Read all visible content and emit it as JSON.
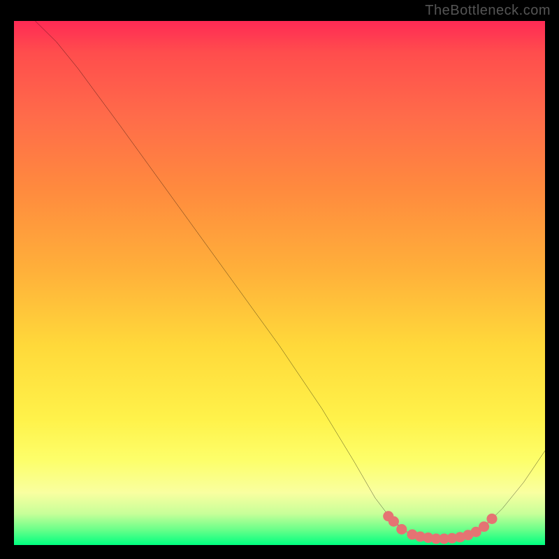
{
  "attribution": "TheBottleneck.com",
  "chart_data": {
    "type": "line",
    "title": "",
    "xlabel": "",
    "ylabel": "",
    "xlim": [
      0,
      100
    ],
    "ylim": [
      0,
      100
    ],
    "grid": false,
    "curve": {
      "name": "bottleneck-curve",
      "color": "#000000",
      "points": [
        {
          "x": 4,
          "y": 100
        },
        {
          "x": 8,
          "y": 96
        },
        {
          "x": 12,
          "y": 91
        },
        {
          "x": 20,
          "y": 80
        },
        {
          "x": 30,
          "y": 66
        },
        {
          "x": 40,
          "y": 52
        },
        {
          "x": 50,
          "y": 38
        },
        {
          "x": 58,
          "y": 26
        },
        {
          "x": 64,
          "y": 16
        },
        {
          "x": 68,
          "y": 9
        },
        {
          "x": 71,
          "y": 5
        },
        {
          "x": 74,
          "y": 2.5
        },
        {
          "x": 77,
          "y": 1.5
        },
        {
          "x": 80,
          "y": 1.2
        },
        {
          "x": 83,
          "y": 1.3
        },
        {
          "x": 86,
          "y": 2
        },
        {
          "x": 89,
          "y": 4
        },
        {
          "x": 92,
          "y": 7
        },
        {
          "x": 96,
          "y": 12
        },
        {
          "x": 100,
          "y": 18
        }
      ]
    },
    "markers": {
      "name": "highlighted-segment",
      "color": "#e57373",
      "radius": 1.0,
      "points": [
        {
          "x": 70.5,
          "y": 5.5
        },
        {
          "x": 71.5,
          "y": 4.5
        },
        {
          "x": 73,
          "y": 3
        },
        {
          "x": 75,
          "y": 2
        },
        {
          "x": 76.5,
          "y": 1.6
        },
        {
          "x": 78,
          "y": 1.4
        },
        {
          "x": 79.5,
          "y": 1.2
        },
        {
          "x": 81,
          "y": 1.2
        },
        {
          "x": 82.5,
          "y": 1.3
        },
        {
          "x": 84,
          "y": 1.5
        },
        {
          "x": 85.5,
          "y": 1.9
        },
        {
          "x": 87,
          "y": 2.5
        },
        {
          "x": 88.5,
          "y": 3.5
        },
        {
          "x": 90,
          "y": 5
        }
      ]
    },
    "gradient_stops": [
      {
        "offset": 0,
        "color": "#ff2a55"
      },
      {
        "offset": 90,
        "color": "#fdff6b"
      },
      {
        "offset": 100,
        "color": "#00ff80"
      }
    ]
  }
}
